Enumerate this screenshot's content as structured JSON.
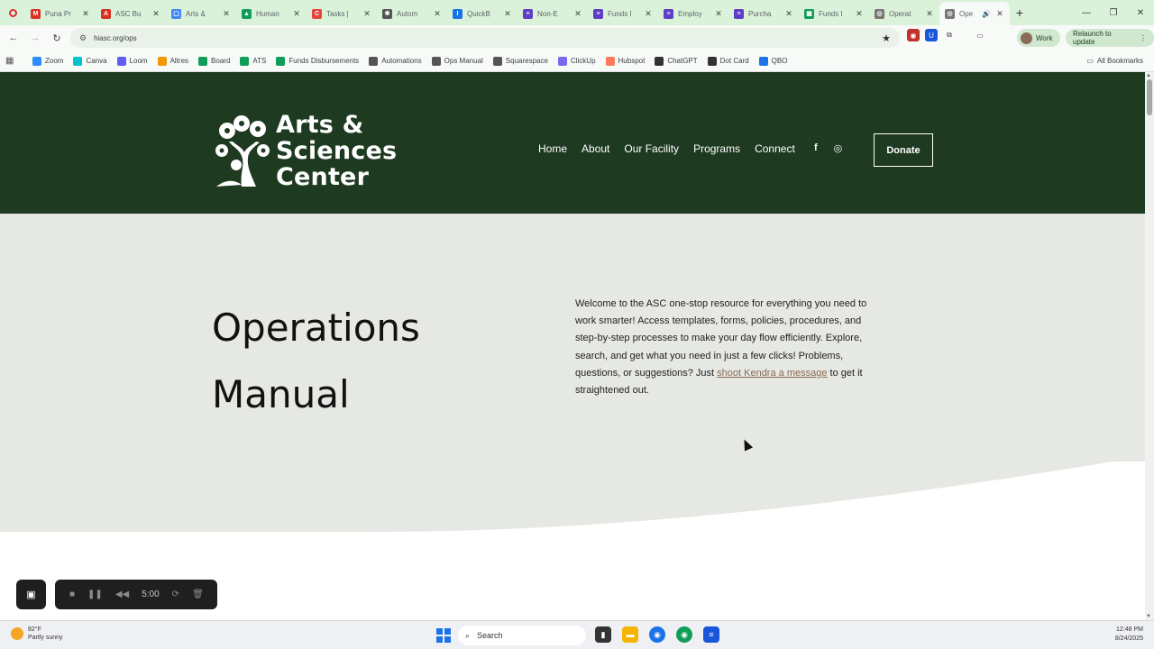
{
  "browser": {
    "tabs": [
      {
        "title": "Puna Pr",
        "icon": "gmail-icon",
        "color": "#d93025",
        "glyph": "M"
      },
      {
        "title": "ASC Bu",
        "icon": "pdf-icon",
        "color": "#d93025",
        "glyph": "A"
      },
      {
        "title": "Arts &",
        "icon": "google-sites-icon",
        "color": "#4285f4",
        "glyph": "▢"
      },
      {
        "title": "Human",
        "icon": "google-drive-icon",
        "color": "#0f9d58",
        "glyph": "▲"
      },
      {
        "title": "Tasks |",
        "icon": "clickup-icon",
        "color": "#e8443a",
        "glyph": "C"
      },
      {
        "title": "Autom",
        "icon": "zapier-icon",
        "color": "#555555",
        "glyph": "✱"
      },
      {
        "title": "QuickB",
        "icon": "quickbase-icon",
        "color": "#1a73e8",
        "glyph": "I"
      },
      {
        "title": "Non-E",
        "icon": "form-icon",
        "color": "#5f3dc4",
        "glyph": "≡"
      },
      {
        "title": "Funds I",
        "icon": "form-icon",
        "color": "#5f3dc4",
        "glyph": "≡"
      },
      {
        "title": "Employ",
        "icon": "doc-icon",
        "color": "#5f3dc4",
        "glyph": "≡"
      },
      {
        "title": "Purcha",
        "icon": "form-icon",
        "color": "#5f3dc4",
        "glyph": "≡"
      },
      {
        "title": "Funds I",
        "icon": "sheets-icon",
        "color": "#0f9d58",
        "glyph": "▦"
      },
      {
        "title": "Operat",
        "icon": "squarespace-icon",
        "color": "#777777",
        "glyph": "◎"
      },
      {
        "title": "Ope",
        "icon": "squarespace-icon",
        "color": "#777777",
        "glyph": "◎",
        "active": true
      }
    ],
    "url": "hiasc.org/ops",
    "profile_label": "Work",
    "relaunch_label": "Relaunch to update",
    "bookmarks": [
      {
        "label": "Zoom",
        "icon": "zoom-icon",
        "color": "#2d8cff"
      },
      {
        "label": "Canva",
        "icon": "canva-icon",
        "color": "#00c4cc"
      },
      {
        "label": "Loom",
        "icon": "loom-icon",
        "color": "#625df5"
      },
      {
        "label": "Altres",
        "icon": "altres-icon",
        "color": "#f29900"
      },
      {
        "label": "Board",
        "icon": "sheets-icon",
        "color": "#0f9d58"
      },
      {
        "label": "ATS",
        "icon": "sheets-icon",
        "color": "#0f9d58"
      },
      {
        "label": "Funds Disbursements",
        "icon": "sheets-icon",
        "color": "#0f9d58"
      },
      {
        "label": "Automations",
        "icon": "zapier-icon",
        "color": "#555555"
      },
      {
        "label": "Ops Manual",
        "icon": "squarespace-icon",
        "color": "#555555"
      },
      {
        "label": "Squarespace",
        "icon": "squarespace-icon",
        "color": "#555555"
      },
      {
        "label": "ClickUp",
        "icon": "clickup-icon",
        "color": "#7b68ee"
      },
      {
        "label": "Hubspot",
        "icon": "hubspot-icon",
        "color": "#ff7a59"
      },
      {
        "label": "ChatGPT",
        "icon": "chatgpt-icon",
        "color": "#333333"
      },
      {
        "label": "Dot Card",
        "icon": "dotcard-icon",
        "color": "#333333"
      },
      {
        "label": "QBO",
        "icon": "quickbooks-icon",
        "color": "#1a73e8"
      }
    ],
    "all_bookmarks_label": "All Bookmarks"
  },
  "site": {
    "logo_lines": [
      "Arts &",
      "Sciences",
      "Center"
    ],
    "nav": [
      "Home",
      "About",
      "Our Facility",
      "Programs",
      "Connect"
    ],
    "donate_label": "Donate",
    "colors": {
      "header": "#1e3a20",
      "hero": "#e6e8e3",
      "link": "#8a6a52"
    }
  },
  "hero": {
    "title_line1": "Operations",
    "title_line2": "Manual",
    "intro_before": "Welcome to the ASC one-stop resource for everything you need to work smarter! Access templates, forms, policies, procedures, and step-by-step processes to make your day flow efficiently.  Explore, search, and get what you need in just a few clicks!  Problems, questions, or suggestions?  Just ",
    "intro_link": "shoot Kendra a message",
    "intro_after": " to get it straightened out."
  },
  "recorder": {
    "time": "5:00"
  },
  "taskbar": {
    "weather_temp": "82°F",
    "weather_desc": "Partly sunny",
    "search_placeholder": "Search",
    "time": "12:48 PM",
    "date": "8/24/2025"
  }
}
